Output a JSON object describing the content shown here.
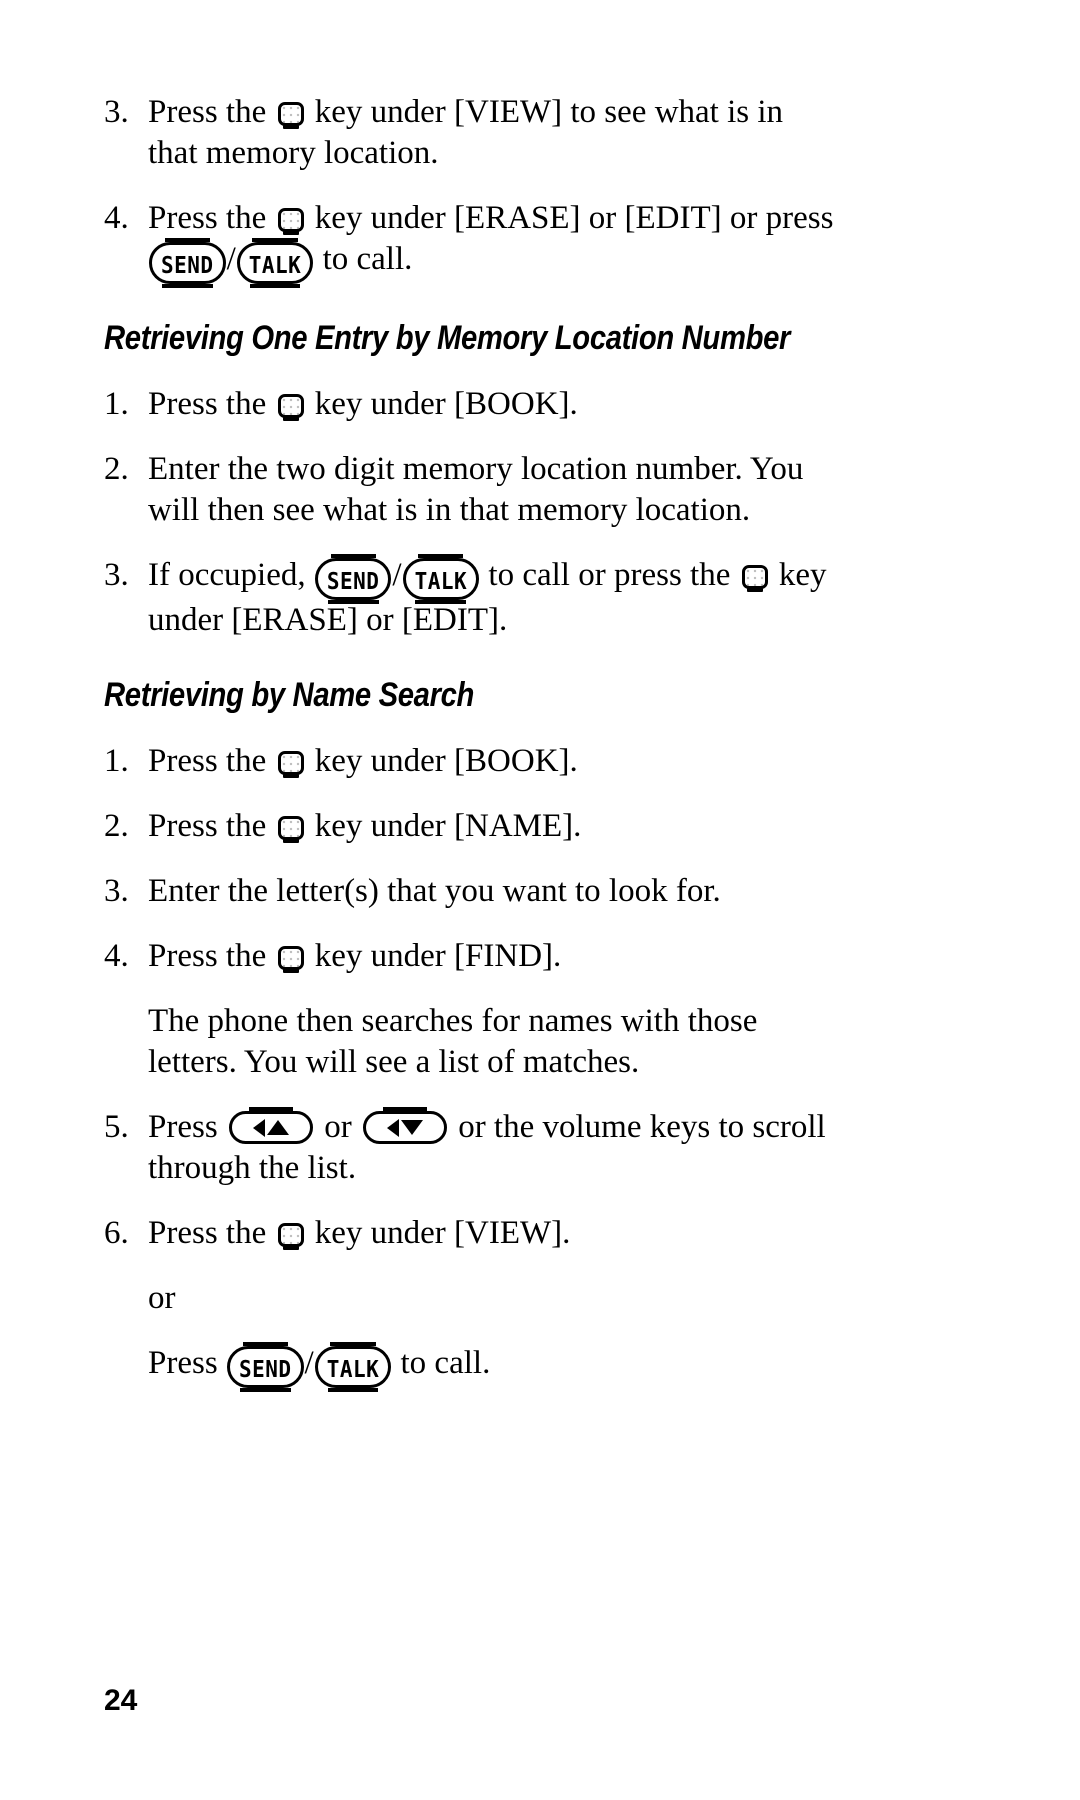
{
  "page": {
    "number": "24",
    "paper_color": "#ffffff",
    "ink_color": "#000000"
  },
  "glyphs": {
    "softkey": "soft-key-icon",
    "send_label": "SEND",
    "talk_label": "TALK",
    "slash": "/",
    "scroll_up_key": "scroll-up-key-icon",
    "scroll_down_key": "scroll-down-key-icon"
  },
  "blocks": [
    {
      "type": "list-item",
      "number": "3.",
      "segments": [
        {
          "t": "text",
          "v": "Press the "
        },
        {
          "t": "softkey"
        },
        {
          "t": "text",
          "v": " key under [VIEW] to see what is in that memory location."
        }
      ]
    },
    {
      "type": "list-item",
      "number": "4.",
      "segments": [
        {
          "t": "text",
          "v": "Press the "
        },
        {
          "t": "softkey"
        },
        {
          "t": "text",
          "v": " key under [ERASE] or [EDIT] or press "
        },
        {
          "t": "send"
        },
        {
          "t": "text",
          "v": "/"
        },
        {
          "t": "talk"
        },
        {
          "t": "text",
          "v": " to call."
        }
      ]
    },
    {
      "type": "heading",
      "text": "Retrieving One Entry by Memory Location Number"
    },
    {
      "type": "list-item",
      "number": "1.",
      "segments": [
        {
          "t": "text",
          "v": "Press the "
        },
        {
          "t": "softkey"
        },
        {
          "t": "text",
          "v": " key under [BOOK]."
        }
      ]
    },
    {
      "type": "list-item",
      "number": "2.",
      "segments": [
        {
          "t": "text",
          "v": "Enter the two digit memory location number. You will then see what is in that memory location."
        }
      ]
    },
    {
      "type": "list-item",
      "number": "3.",
      "segments": [
        {
          "t": "text",
          "v": "If occupied, "
        },
        {
          "t": "send"
        },
        {
          "t": "text",
          "v": "/"
        },
        {
          "t": "talk"
        },
        {
          "t": "text",
          "v": " to call or press the "
        },
        {
          "t": "softkey"
        },
        {
          "t": "text",
          "v": " key under [ERASE] or [EDIT]."
        }
      ]
    },
    {
      "type": "heading",
      "text": "Retrieving by Name Search"
    },
    {
      "type": "list-item",
      "number": "1.",
      "segments": [
        {
          "t": "text",
          "v": "Press the "
        },
        {
          "t": "softkey"
        },
        {
          "t": "text",
          "v": " key under [BOOK]."
        }
      ]
    },
    {
      "type": "list-item",
      "number": "2.",
      "segments": [
        {
          "t": "text",
          "v": "Press the "
        },
        {
          "t": "softkey"
        },
        {
          "t": "text",
          "v": " key under [NAME]."
        }
      ]
    },
    {
      "type": "list-item",
      "number": "3.",
      "segments": [
        {
          "t": "text",
          "v": "Enter the letter(s) that you want to look for."
        }
      ]
    },
    {
      "type": "list-item",
      "number": "4.",
      "segments": [
        {
          "t": "text",
          "v": "Press the "
        },
        {
          "t": "softkey"
        },
        {
          "t": "text",
          "v": " key under [FIND]."
        }
      ]
    },
    {
      "type": "continuation",
      "segments": [
        {
          "t": "text",
          "v": "The phone then searches for names with those letters. You will see a list of matches."
        }
      ]
    },
    {
      "type": "list-item",
      "number": "5.",
      "segments": [
        {
          "t": "text",
          "v": "Press "
        },
        {
          "t": "scroll-up"
        },
        {
          "t": "text",
          "v": " or "
        },
        {
          "t": "scroll-down"
        },
        {
          "t": "text",
          "v": " or the volume keys to scroll through the list."
        }
      ]
    },
    {
      "type": "list-item",
      "number": "6.",
      "segments": [
        {
          "t": "text",
          "v": "Press the "
        },
        {
          "t": "softkey"
        },
        {
          "t": "text",
          "v": " key under [VIEW]."
        }
      ]
    },
    {
      "type": "continuation",
      "segments": [
        {
          "t": "text",
          "v": "or"
        }
      ]
    },
    {
      "type": "continuation",
      "segments": [
        {
          "t": "text",
          "v": "Press "
        },
        {
          "t": "send"
        },
        {
          "t": "text",
          "v": "/"
        },
        {
          "t": "talk"
        },
        {
          "t": "text",
          "v": "  to call."
        }
      ]
    }
  ]
}
